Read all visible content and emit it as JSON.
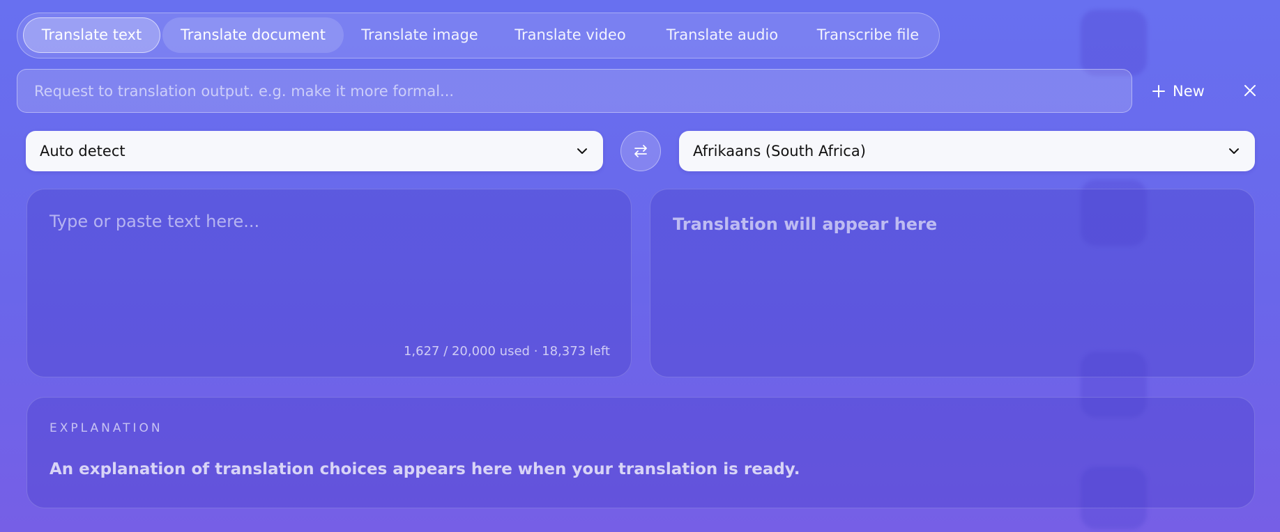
{
  "tabs": [
    {
      "label": "Translate text",
      "state": "active"
    },
    {
      "label": "Translate document",
      "state": "hover"
    },
    {
      "label": "Translate image",
      "state": "normal"
    },
    {
      "label": "Translate video",
      "state": "normal"
    },
    {
      "label": "Translate audio",
      "state": "normal"
    },
    {
      "label": "Transcribe file",
      "state": "normal"
    }
  ],
  "request": {
    "placeholder": "Request to translation output. e.g. make it more formal...",
    "value": ""
  },
  "actions": {
    "new_label": "New",
    "new_icon": "plus-icon",
    "close_icon": "close-icon"
  },
  "languages": {
    "source": "Auto detect",
    "target": "Afrikaans (South Africa)",
    "swap_icon": "swap-arrows-icon"
  },
  "source_box": {
    "placeholder": "Type or paste text here...",
    "value": "",
    "counter": "1,627 / 20,000 used · 18,373 left"
  },
  "output_box": {
    "placeholder": "Translation will appear here"
  },
  "explanation": {
    "heading": "EXPLANATION",
    "body": "An explanation of translation choices appears here when your translation is ready."
  },
  "colors": {
    "background_top": "#6870f0",
    "background_bottom": "#765fe6",
    "select_background": "#f7f8fc"
  }
}
